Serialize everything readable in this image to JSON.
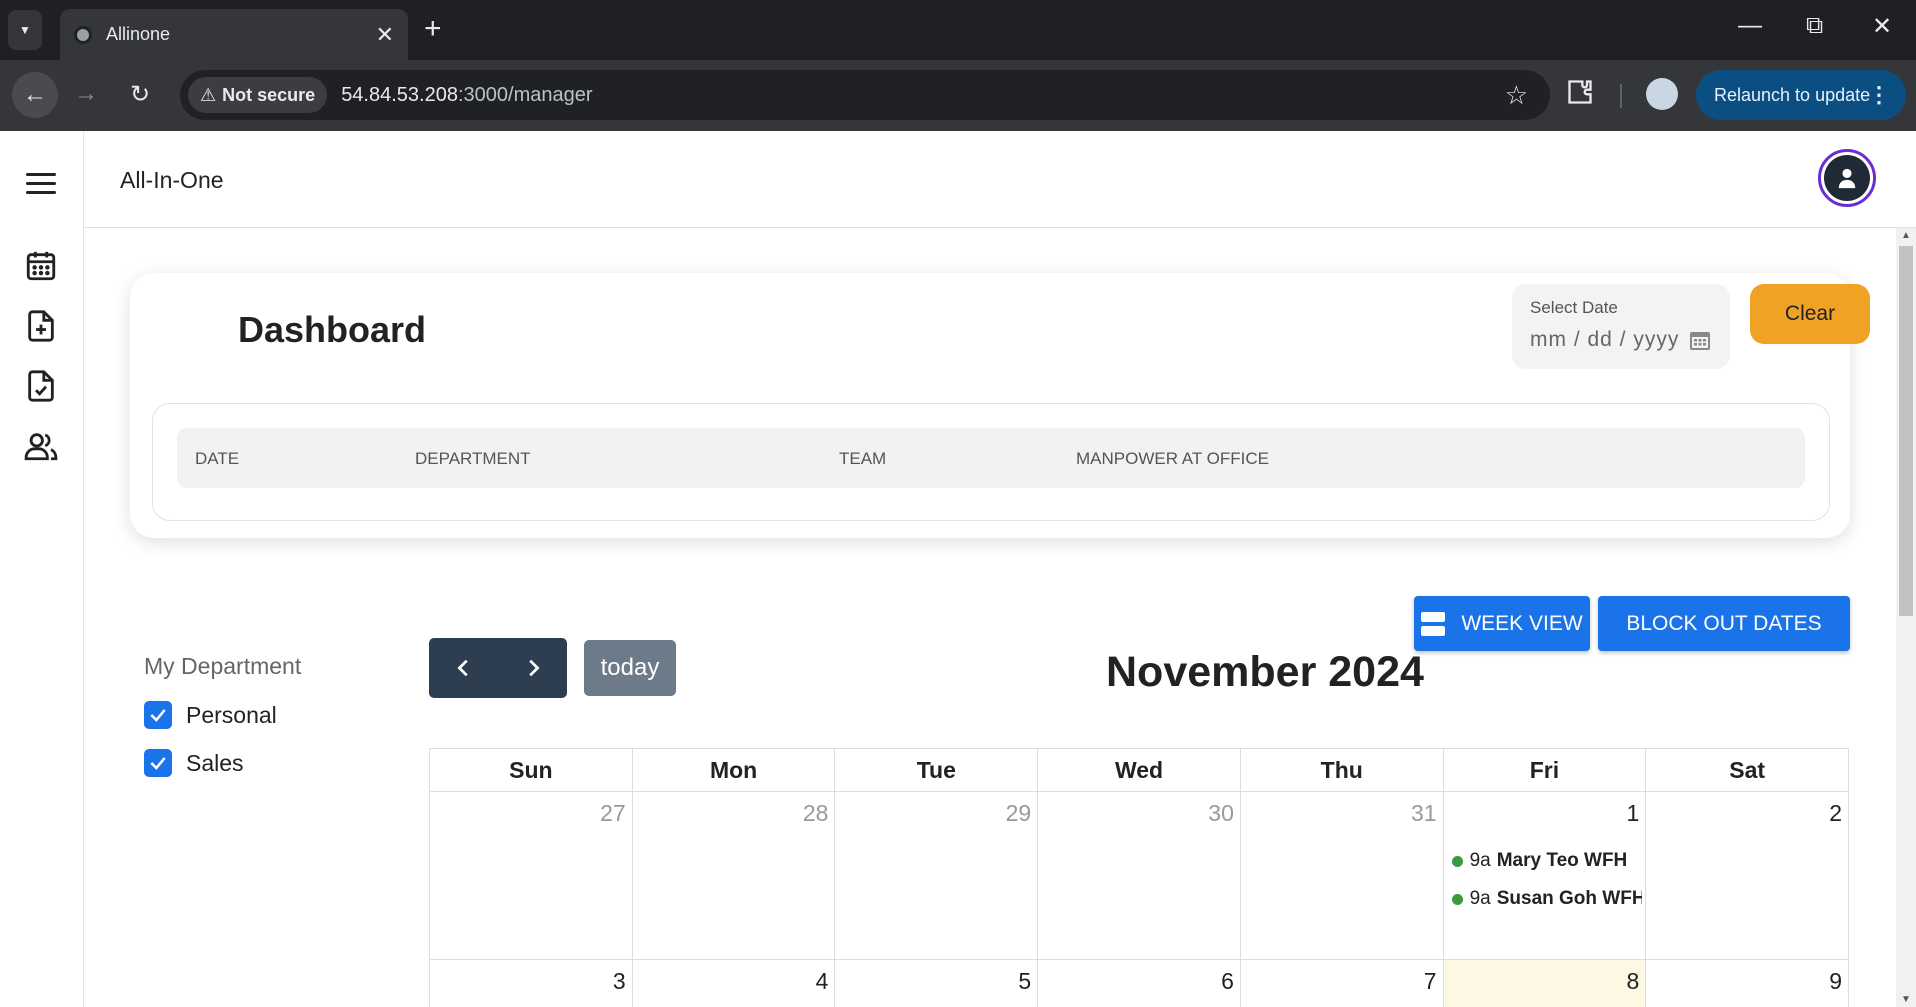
{
  "browser": {
    "tab_title": "Allinone",
    "security_label": "Not secure",
    "url_host": "54.84.53.208",
    "url_path": ":3000/manager",
    "relaunch_label": "Relaunch to update"
  },
  "app": {
    "title": "All-In-One",
    "sidebar_icons": [
      "calendar-icon",
      "file-add-icon",
      "file-check-icon",
      "people-icon"
    ]
  },
  "dashboard": {
    "title": "Dashboard",
    "date_field": {
      "label": "Select Date",
      "placeholder": "mm / dd / yyyy"
    },
    "clear_label": "Clear",
    "table_headers": [
      "DATE",
      "DEPARTMENT",
      "TEAM",
      "MANPOWER AT OFFICE"
    ]
  },
  "actions": {
    "week_view_label": "WEEK VIEW",
    "block_out_label": "BLOCK OUT DATES"
  },
  "filters": {
    "title": "My Department",
    "items": [
      {
        "label": "Personal",
        "checked": true
      },
      {
        "label": "Sales",
        "checked": true
      }
    ]
  },
  "calendar": {
    "today_label": "today",
    "month_title": "November 2024",
    "weekdays": [
      "Sun",
      "Mon",
      "Tue",
      "Wed",
      "Thu",
      "Fri",
      "Sat"
    ],
    "week1": [
      "27",
      "28",
      "29",
      "30",
      "31",
      "1",
      "2"
    ],
    "week2": [
      "3",
      "4",
      "5",
      "6",
      "7",
      "8",
      "9"
    ],
    "events": [
      {
        "time": "9a",
        "title": "Mary Teo WFH"
      },
      {
        "time": "9a",
        "title": "Susan Goh WFH"
      }
    ],
    "event_color": "#3c9a3c",
    "today_highlight": "#fcf8e3"
  }
}
